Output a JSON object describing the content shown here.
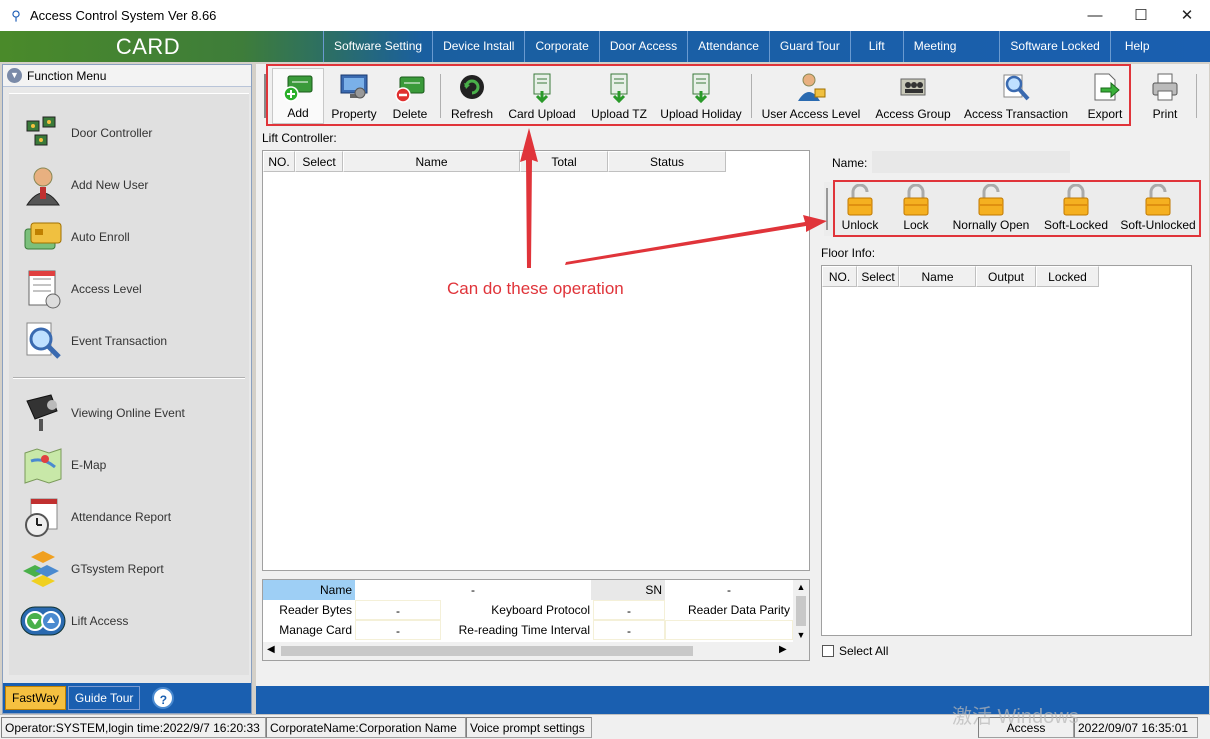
{
  "window": {
    "title": "Access Control System  Ver 8.66",
    "min": "—",
    "max": "☐",
    "close": "✕"
  },
  "brand": "CARD",
  "menu": [
    "Software Setting",
    "Device Install",
    "Corporate",
    "Door Access",
    "Attendance",
    "Guard Tour",
    "Lift",
    "Meeting",
    "Software Locked",
    "Help"
  ],
  "sidebar": {
    "header": "Function Menu",
    "items": [
      {
        "label": "Door Controller",
        "icon": "door-controller-icon"
      },
      {
        "label": "Add New User",
        "icon": "user-icon"
      },
      {
        "label": "Auto Enroll",
        "icon": "card-icon"
      },
      {
        "label": "Access Level",
        "icon": "document-icon"
      },
      {
        "label": "Event Transaction",
        "icon": "magnifier-icon"
      },
      {
        "label": "Viewing Online Event",
        "icon": "camera-icon"
      },
      {
        "label": "E-Map",
        "icon": "map-icon"
      },
      {
        "label": "Attendance Report",
        "icon": "clock-icon"
      },
      {
        "label": "GTsystem Report",
        "icon": "blocks-icon"
      },
      {
        "label": "Lift Access",
        "icon": "elevator-icon"
      }
    ],
    "tabs": {
      "fastway": "FastWay",
      "guide": "Guide Tour",
      "help": "?"
    }
  },
  "toolbar": {
    "add": "Add",
    "property": "Property",
    "delete": "Delete",
    "refresh": "Refresh",
    "card_upload": "Card Upload",
    "upload_tz": "Upload TZ",
    "upload_holiday": "Upload Holiday",
    "user_access_level": "User Access Level",
    "access_group": "Access Group",
    "access_transaction": "Access Transaction",
    "export": "Export",
    "print": "Print"
  },
  "lift_controller": {
    "label": "Lift Controller:",
    "columns": [
      "NO.",
      "Select",
      "Name",
      "Total",
      "Status"
    ]
  },
  "detail": {
    "name_label": "Name",
    "name_value": "-",
    "sn_label": "SN",
    "sn_value": "-",
    "reader_bytes_label": "Reader Bytes",
    "reader_bytes_value": "-",
    "keyboard_protocol_label": "Keyboard Protocol",
    "keyboard_protocol_value": "-",
    "reader_parity_label": "Reader Data Parity",
    "manage_card_label": "Manage Card",
    "manage_card_value": "-",
    "rereading_label": "Re-reading Time Interval",
    "rereading_value": "-"
  },
  "right_panel": {
    "name_label": "Name:",
    "lock_buttons": [
      "Unlock",
      "Lock",
      "Nornally Open",
      "Soft-Locked",
      "Soft-Unlocked"
    ],
    "floor_label": "Floor Info:",
    "floor_columns": [
      "NO.",
      "Select",
      "Name",
      "Output",
      "Locked"
    ],
    "select_all": "Select All"
  },
  "annotation": "Can do these operation",
  "status": {
    "operator": "Operator:SYSTEM,login time:2022/9/7 16:20:33",
    "corporate": "CorporateName:Corporation Name",
    "voice": "Voice prompt settings",
    "access": "Access",
    "datetime": "2022/09/07 16:35:01",
    "watermark": "激活 Windows"
  },
  "colors": {
    "accent": "#1a5fb0",
    "annotation": "#e0343a",
    "lock": "#f5b020"
  }
}
